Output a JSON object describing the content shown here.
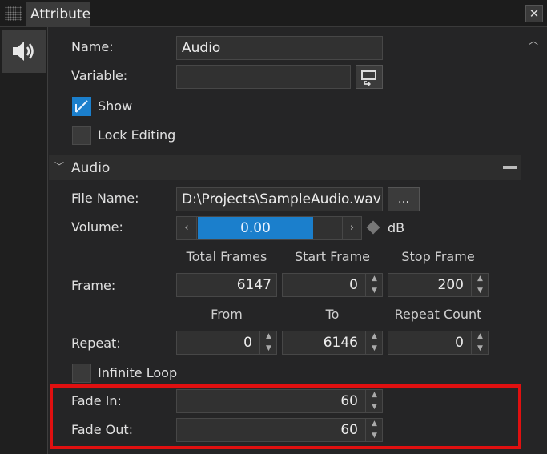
{
  "panel": {
    "tab_label": "Attribute",
    "close_glyph": "✕"
  },
  "icons": {
    "sidebar": "speaker-icon",
    "grip": "grip-icon",
    "scroll_up": "chevron-up-icon",
    "collapse": "chevron-down-icon",
    "collapse_section": "minus-icon",
    "variable_picker": "picker-icon"
  },
  "general": {
    "name_label": "Name:",
    "name_value": "Audio",
    "variable_label": "Variable:",
    "variable_value": "",
    "show_label": "Show",
    "show_checked": true,
    "lock_label": "Lock Editing",
    "lock_checked": false
  },
  "audio": {
    "section_title": "Audio",
    "file_name_label": "File Name:",
    "file_name_value": "D:\\Projects\\SampleAudio.wav",
    "browse_label": "...",
    "volume_label": "Volume:",
    "volume_value": "0.00",
    "volume_unit": "dB",
    "frame_label": "Frame:",
    "frame_columns": [
      "Total Frames",
      "Start Frame",
      "Stop Frame"
    ],
    "total_frames": "6147",
    "start_frame": "0",
    "stop_frame": "200",
    "repeat_label": "Repeat:",
    "repeat_columns": [
      "From",
      "To",
      "Repeat Count"
    ],
    "repeat_from": "0",
    "repeat_to": "6146",
    "repeat_count": "0",
    "infinite_loop_label": "Infinite Loop",
    "infinite_loop_checked": false,
    "fade_in_label": "Fade In:",
    "fade_in_value": "60",
    "fade_out_label": "Fade Out:",
    "fade_out_value": "60"
  },
  "colors": {
    "accent": "#1b7fcc",
    "highlight": "#e01010",
    "background": "#252526"
  }
}
